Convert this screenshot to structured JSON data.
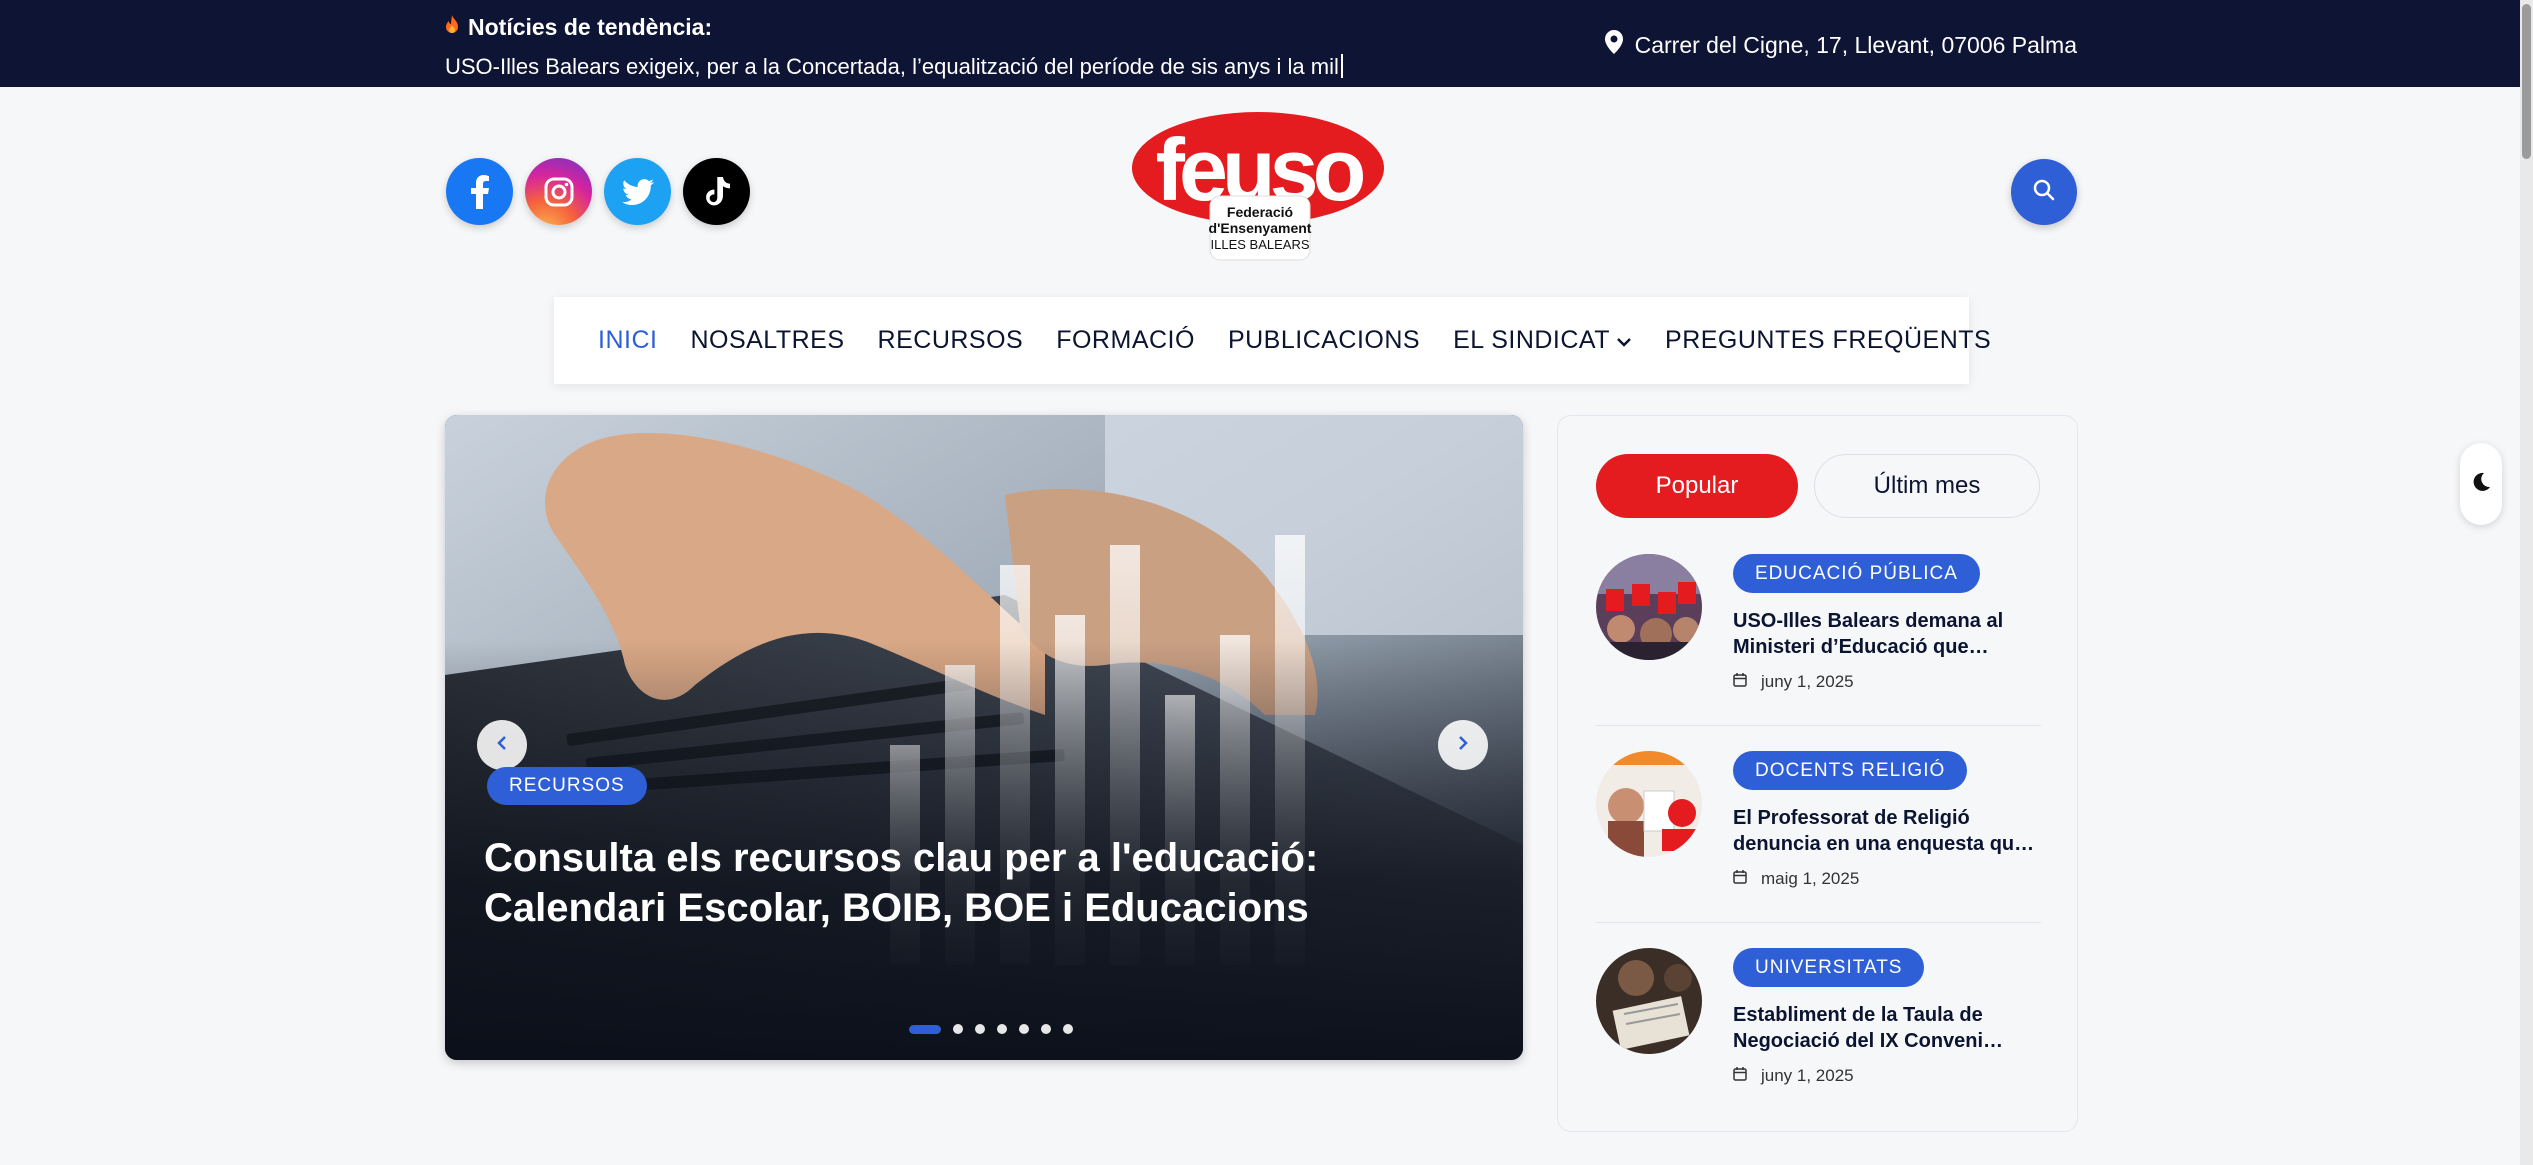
{
  "topbar": {
    "trending_label": "Notícies de tendència:",
    "trending_text": "USO-Illes Balears exigeix, per a la Concertada, l’equalització del període de sis anys i la mil",
    "address": "Carrer del Cigne, 17, Llevant, 07006 Palma"
  },
  "header": {
    "socials": [
      "facebook-icon",
      "instagram-icon",
      "twitter-icon",
      "tiktok-icon"
    ],
    "logo": {
      "wordmark": "feuso",
      "line1": "Federació",
      "line2": "d'Ensenyament",
      "line3": "ILLES BALEARS"
    }
  },
  "nav": {
    "items": [
      {
        "label": "INICI",
        "active": true
      },
      {
        "label": "NOSALTRES"
      },
      {
        "label": "RECURSOS"
      },
      {
        "label": "FORMACIÓ"
      },
      {
        "label": "PUBLICACIONS"
      },
      {
        "label": "EL SINDICAT",
        "dropdown": true
      },
      {
        "label": "PREGUNTES FREQÜENTS"
      }
    ]
  },
  "slider": {
    "category": "RECURSOS",
    "title": "Consulta els recursos clau per a l'educació: Calendari Escolar, BOIB, BOE i Educacions",
    "slide_count": 7,
    "active_slide": 1
  },
  "sidebar": {
    "tabs": [
      {
        "label": "Popular",
        "active": true
      },
      {
        "label": "Últim mes"
      }
    ],
    "posts": [
      {
        "category": "EDUCACIÓ PÚBLICA",
        "title": "USO-Illes Balears demana al Ministeri d’Educació que…",
        "date": "juny 1, 2025"
      },
      {
        "category": "DOCENTS RELIGIÓ",
        "title": "El Professorat de Religió denuncia en una enquesta qu…",
        "date": "maig 1, 2025"
      },
      {
        "category": "UNIVERSITATS",
        "title": "Establiment de la Taula de Negociació del IX Conveni…",
        "date": "juny 1, 2025"
      }
    ]
  },
  "colors": {
    "accent": "#2f5fd6",
    "brand_red": "#e41b1f",
    "topbar": "#0d1434"
  }
}
